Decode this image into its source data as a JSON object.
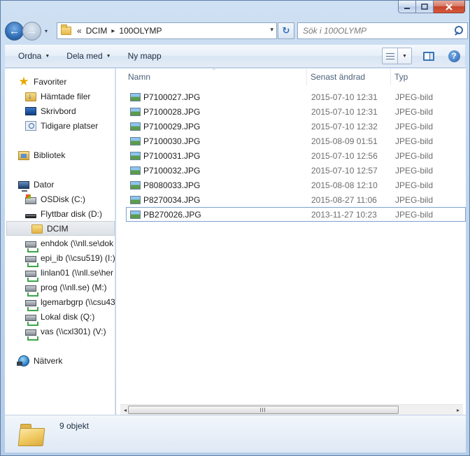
{
  "window": {
    "caption_buttons": {
      "minimize": "–",
      "maximize": "□",
      "close": "✕"
    }
  },
  "nav": {
    "back_glyph": "←",
    "forward_glyph": "→",
    "history_glyph": "▾"
  },
  "address": {
    "overflow": "«",
    "crumbs": [
      "DCIM",
      "100OLYMP"
    ],
    "separator": "▸",
    "dropdown_glyph": "▾",
    "refresh_glyph": "↻"
  },
  "search": {
    "placeholder": "Sök i 100OLYMP"
  },
  "toolbar": {
    "organize_label": "Ordna",
    "share_label": "Dela med",
    "new_folder_label": "Ny mapp",
    "dropdown_glyph": "▼",
    "help_glyph": "?"
  },
  "sidebar": {
    "favorites": {
      "label": "Favoriter",
      "items": [
        "Hämtade filer",
        "Skrivbord",
        "Tidigare platser"
      ]
    },
    "libraries": {
      "label": "Bibliotek"
    },
    "computer": {
      "label": "Dator",
      "items": [
        "OSDisk (C:)",
        "Flyttbar disk (D:)",
        "DCIM",
        "enhdok (\\\\nll.se\\dok",
        "epi_ib (\\\\csu519) (I:)",
        "linlan01 (\\\\nll.se\\her",
        "prog (\\\\nll.se) (M:)",
        "lgemarbgrp (\\\\csu43",
        "Lokal disk (Q:)",
        "vas (\\\\cxl301) (V:)"
      ]
    },
    "network": {
      "label": "Nätverk"
    }
  },
  "files": {
    "columns": [
      "Namn",
      "Senast ändrad",
      "Typ"
    ],
    "sort_glyph": "^",
    "rows": [
      {
        "name": "P7100027.JPG",
        "date": "2015-07-10 12:31",
        "type": "JPEG-bild"
      },
      {
        "name": "P7100028.JPG",
        "date": "2015-07-10 12:31",
        "type": "JPEG-bild"
      },
      {
        "name": "P7100029.JPG",
        "date": "2015-07-10 12:32",
        "type": "JPEG-bild"
      },
      {
        "name": "P7100030.JPG",
        "date": "2015-08-09 01:51",
        "type": "JPEG-bild"
      },
      {
        "name": "P7100031.JPG",
        "date": "2015-07-10 12:56",
        "type": "JPEG-bild"
      },
      {
        "name": "P7100032.JPG",
        "date": "2015-07-10 12:57",
        "type": "JPEG-bild"
      },
      {
        "name": "P8080033.JPG",
        "date": "2015-08-08 12:10",
        "type": "JPEG-bild"
      },
      {
        "name": "P8270034.JPG",
        "date": "2015-08-27 11:06",
        "type": "JPEG-bild"
      },
      {
        "name": "PB270026.JPG",
        "date": "2013-11-27 10:23",
        "type": "JPEG-bild"
      }
    ]
  },
  "scrollbar": {
    "left_glyph": "◂",
    "right_glyph": "▸"
  },
  "details": {
    "count": "9 objekt"
  }
}
